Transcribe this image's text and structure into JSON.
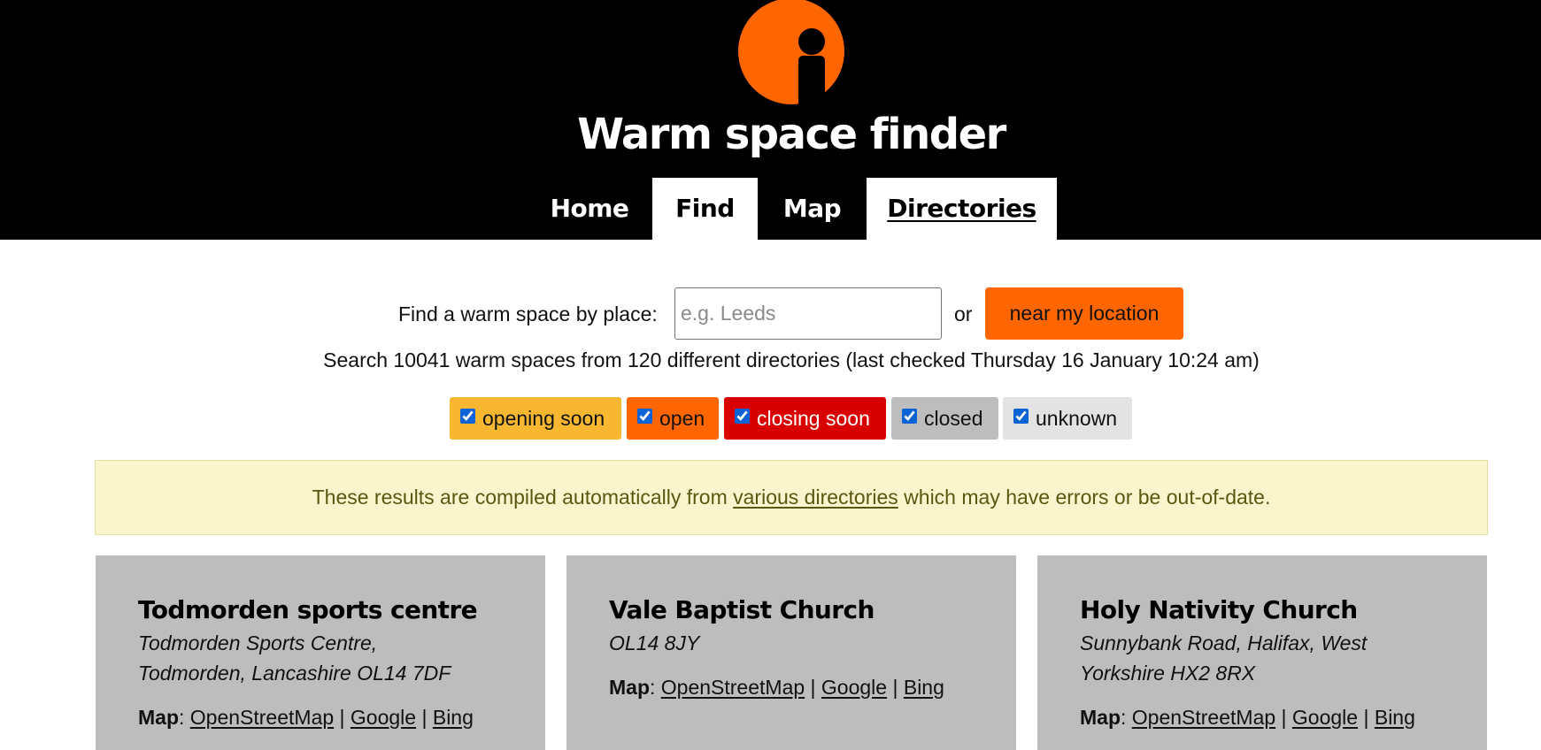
{
  "colors": {
    "brand_orange": "#ff6600",
    "header_bg": "#000000",
    "opening_soon": "#f7b731",
    "open": "#ff6600",
    "closing_soon": "#d90000",
    "closed": "#bdbdbd",
    "unknown": "#e3e3e3",
    "notice_bg": "#faf5cc",
    "card_bg": "#bdbdbd"
  },
  "header": {
    "logo_icon": "info-person-icon",
    "title": "Warm space finder",
    "nav": [
      {
        "label": "Home",
        "active": false
      },
      {
        "label": "Find",
        "active": true
      },
      {
        "label": "Map",
        "active": false
      },
      {
        "label": "Directories",
        "active": true
      }
    ]
  },
  "search": {
    "label": "Find a warm space by place:",
    "input_value": "",
    "placeholder": "e.g. Leeds",
    "or_text": "or",
    "location_button": "near my location",
    "info": "Search 10041 warm spaces from 120 different directories (last checked Thursday 16 January 10:24 am)"
  },
  "filters": [
    {
      "label": "opening soon",
      "checked": true
    },
    {
      "label": "open",
      "checked": true
    },
    {
      "label": "closing soon",
      "checked": true
    },
    {
      "label": "closed",
      "checked": true
    },
    {
      "label": "unknown",
      "checked": true
    }
  ],
  "notice": {
    "before": "These results are compiled automatically from ",
    "link": "various directories",
    "after": " which may have errors or be out-of-date."
  },
  "cards": [
    {
      "name": "Todmorden sports centre",
      "address_line1": "Todmorden Sports Centre,",
      "address_line2": "Todmorden, Lancashire OL14 7DF",
      "map_label": "Map",
      "map_links": [
        "OpenStreetMap",
        "Google",
        "Bing"
      ]
    },
    {
      "name": "Vale Baptist Church",
      "address_line1": "OL14 8JY",
      "address_line2": "",
      "map_label": "Map",
      "map_links": [
        "OpenStreetMap",
        "Google",
        "Bing"
      ]
    },
    {
      "name": "Holy Nativity Church",
      "address_line1": "Sunnybank Road, Halifax, West",
      "address_line2": "Yorkshire HX2 8RX",
      "map_label": "Map",
      "map_links": [
        "OpenStreetMap",
        "Google",
        "Bing"
      ]
    }
  ]
}
